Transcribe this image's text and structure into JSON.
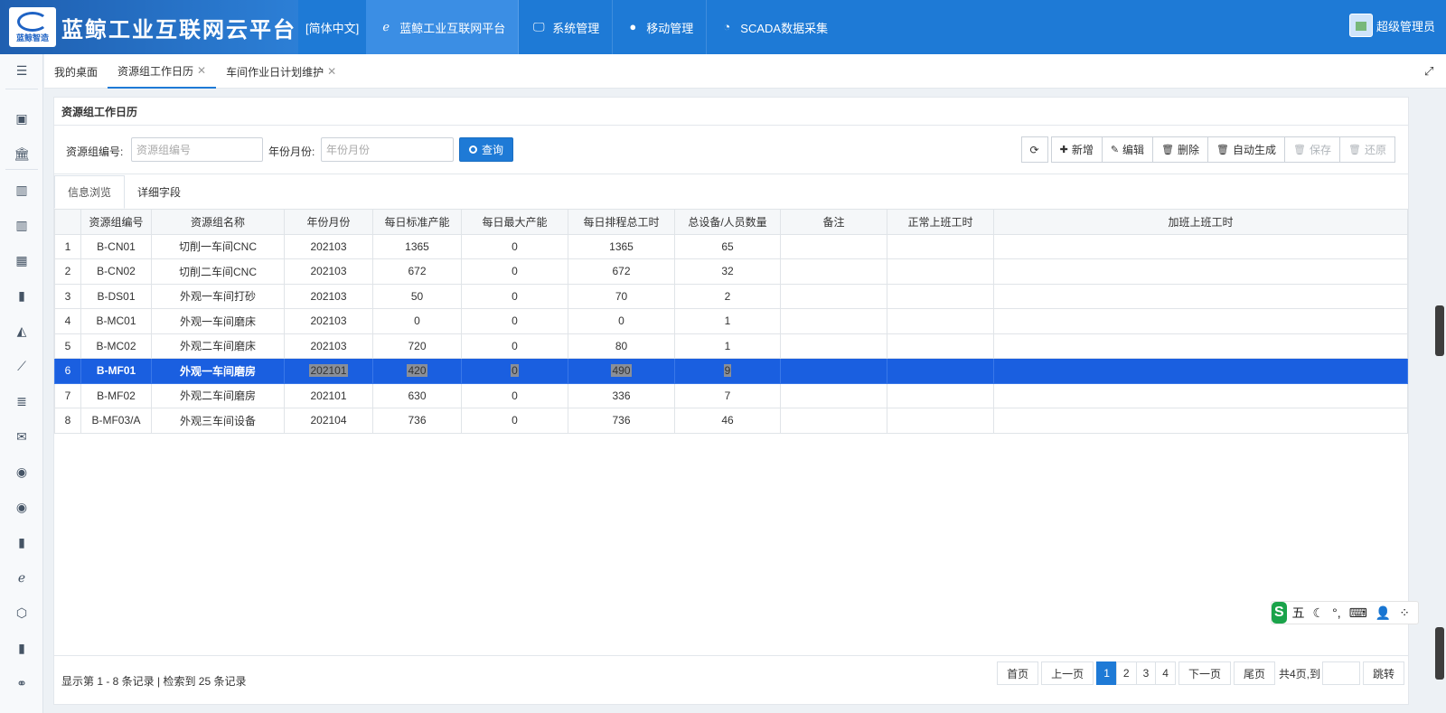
{
  "app": {
    "logo_small": "蓝鲸智造",
    "title": "蓝鲸工业互联网云平台",
    "language": "[简体中文]"
  },
  "top_nav": [
    {
      "label": "蓝鲸工业互联网平台",
      "icon": "ie-icon",
      "active": true
    },
    {
      "label": "系统管理",
      "icon": "monitor-icon",
      "active": false
    },
    {
      "label": "移动管理",
      "icon": "android-icon",
      "active": false
    },
    {
      "label": "SCADA数据采集",
      "icon": "dashboard-icon",
      "active": false
    }
  ],
  "user": {
    "name": "超级管理员"
  },
  "page_tabs": [
    {
      "label": "我的桌面",
      "closable": false,
      "active": false
    },
    {
      "label": "资源组工作日历",
      "closable": true,
      "active": true
    },
    {
      "label": "车间作业日计划维护",
      "closable": true,
      "active": false
    }
  ],
  "card": {
    "title": "资源组工作日历"
  },
  "search": {
    "group_code_label": "资源组编号:",
    "group_code_placeholder": "资源组编号",
    "year_month_label": "年份月份:",
    "year_month_placeholder": "年份月份",
    "query_label": "查询"
  },
  "toolbar": {
    "add": "新增",
    "edit": "编辑",
    "delete": "删除",
    "auto_generate": "自动生成",
    "save": "保存",
    "restore": "还原"
  },
  "sub_tabs": {
    "browse": "信息浏览",
    "detail": "详细字段"
  },
  "table": {
    "columns": [
      "",
      "资源组编号",
      "资源组名称",
      "年份月份",
      "每日标准产能",
      "每日最大产能",
      "每日排程总工时",
      "总设备/人员数量",
      "备注",
      "正常上班工时",
      "加班上班工时"
    ],
    "rows": [
      {
        "n": "1",
        "code": "B-CN01",
        "name": "切削一车间CNC",
        "ym": "202103",
        "std": "1365",
        "max": "0",
        "hours": "1365",
        "qty": "65",
        "note": "",
        "normal": "",
        "ot": ""
      },
      {
        "n": "2",
        "code": "B-CN02",
        "name": "切削二车间CNC",
        "ym": "202103",
        "std": "672",
        "max": "0",
        "hours": "672",
        "qty": "32",
        "note": "",
        "normal": "",
        "ot": ""
      },
      {
        "n": "3",
        "code": "B-DS01",
        "name": "外观一车间打砂",
        "ym": "202103",
        "std": "50",
        "max": "0",
        "hours": "70",
        "qty": "2",
        "note": "",
        "normal": "",
        "ot": ""
      },
      {
        "n": "4",
        "code": "B-MC01",
        "name": "外观一车间磨床",
        "ym": "202103",
        "std": "0",
        "max": "0",
        "hours": "0",
        "qty": "1",
        "note": "",
        "normal": "",
        "ot": ""
      },
      {
        "n": "5",
        "code": "B-MC02",
        "name": "外观二车间磨床",
        "ym": "202103",
        "std": "720",
        "max": "0",
        "hours": "80",
        "qty": "1",
        "note": "",
        "normal": "",
        "ot": ""
      },
      {
        "n": "6",
        "code": "B-MF01",
        "name": "外观一车间磨房",
        "ym": "202101",
        "std": "420",
        "max": "0",
        "hours": "490",
        "qty": "9",
        "note": "",
        "normal": "",
        "ot": "",
        "selected": true
      },
      {
        "n": "7",
        "code": "B-MF02",
        "name": "外观二车间磨房",
        "ym": "202101",
        "std": "630",
        "max": "0",
        "hours": "336",
        "qty": "7",
        "note": "",
        "normal": "",
        "ot": ""
      },
      {
        "n": "8",
        "code": "B-MF03/A",
        "name": "外观三车间设备",
        "ym": "202104",
        "std": "736",
        "max": "0",
        "hours": "736",
        "qty": "46",
        "note": "",
        "normal": "",
        "ot": ""
      }
    ]
  },
  "footer": {
    "summary": "显示第 1 - 8 条记录 | 检索到 25 条记录",
    "first": "首页",
    "prev": "上一页",
    "pages": [
      "1",
      "2",
      "3",
      "4"
    ],
    "current_page": "1",
    "next": "下一页",
    "last": "尾页",
    "total": "共4页,到",
    "jump": "跳转"
  },
  "ime": {
    "logo": "S",
    "mode": "五",
    "items": [
      "☾",
      "°,",
      "⌨",
      "👤",
      "⁘"
    ]
  },
  "colors": {
    "primary": "#1e7ad6",
    "selected_row": "#1a5fe0",
    "topbar": "#1e7ad6"
  }
}
